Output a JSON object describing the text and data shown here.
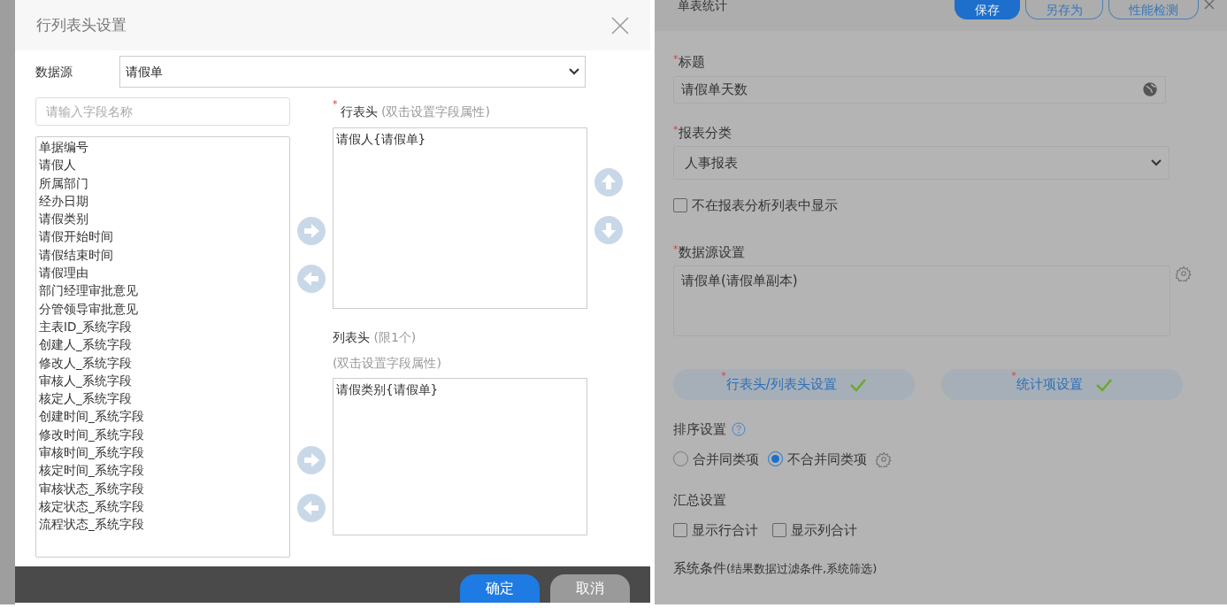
{
  "dialog": {
    "title": "行列表头设置",
    "data_source": {
      "label": "数据源",
      "value": "请假单"
    },
    "search": {
      "placeholder": "请输入字段名称"
    },
    "fields": [
      "单据编号",
      "请假人",
      "所属部门",
      "经办日期",
      "请假类别",
      "请假开始时间",
      "请假结束时间",
      "请假理由",
      "部门经理审批意见",
      "分管领导审批意见",
      "主表ID_系统字段",
      "创建人_系统字段",
      "修改人_系统字段",
      "审核人_系统字段",
      "核定人_系统字段",
      "创建时间_系统字段",
      "修改时间_系统字段",
      "审核时间_系统字段",
      "核定时间_系统字段",
      "审核状态_系统字段",
      "核定状态_系统字段",
      "流程状态_系统字段"
    ],
    "row_header": {
      "label": "行表头",
      "mark": "*",
      "hint": "(双击设置字段属性)",
      "items": [
        "请假人{请假单}"
      ]
    },
    "column_header": {
      "label": "列表头",
      "limit": "(限1个)",
      "hint": "(双击设置字段属性)",
      "items": [
        "请假类别{请假单}"
      ]
    },
    "buttons": [
      {
        "label": "确定",
        "kind": "primary"
      },
      {
        "label": "取消",
        "kind": "secondary"
      }
    ]
  },
  "form": {
    "title": "单表统计",
    "buttons": [
      {
        "label": "保存",
        "kind": "primary"
      },
      {
        "label": "另存为",
        "kind": "outline"
      },
      {
        "label": "性能检测",
        "kind": "outline"
      }
    ],
    "title_field": {
      "label": "标题",
      "mark": "*",
      "value": "请假单天数"
    },
    "category": {
      "label": "报表分类",
      "mark": "*",
      "value": "人事报表"
    },
    "hide_checkbox": {
      "label": "不在报表分析列表中显示",
      "checked": false
    },
    "datasource_setting": {
      "label": "数据源设置",
      "mark": "*",
      "value": "请假单(请假单副本)"
    },
    "setting_buttons": [
      {
        "label": "行表头/列表头设置",
        "mark": "*",
        "done": true
      },
      {
        "label": "统计项设置",
        "mark": "*",
        "done": true
      }
    ],
    "sort": {
      "label": "排序设置",
      "options": [
        {
          "label": "合并同类项",
          "selected": false
        },
        {
          "label": "不合并同类项",
          "selected": true
        }
      ]
    },
    "summary": {
      "label": "汇总设置",
      "options": [
        {
          "label": "显示行合计",
          "checked": false
        },
        {
          "label": "显示列合计",
          "checked": false
        }
      ]
    },
    "system_conditions": {
      "label": "系统条件",
      "hint": "(结果数据过滤条件,系统筛选)"
    }
  }
}
